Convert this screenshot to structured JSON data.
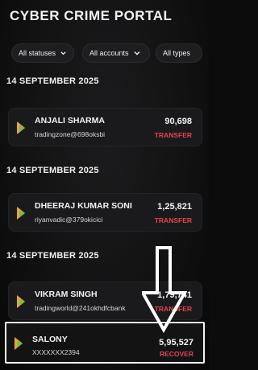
{
  "page": {
    "title": "CYBER CRIME PORTAL"
  },
  "filters": [
    {
      "label": "All statuses",
      "has_chevron": true
    },
    {
      "label": "All accounts",
      "has_chevron": true
    },
    {
      "label": "All types",
      "has_chevron": false
    }
  ],
  "groups": [
    {
      "date": "14 SEPTEMBER 2025",
      "transaction": {
        "name": "ANJALI SHARMA",
        "account": "tradingzone@698oksbi",
        "amount": "90,698",
        "type": "TRANSFER"
      }
    },
    {
      "date": "14 SEPTEMBER 2025",
      "transaction": {
        "name": "DHEERAJ KUMAR SONI",
        "account": "riyanvadic@379okicici",
        "amount": "1,25,821",
        "type": "TRANSFER"
      }
    },
    {
      "date": "14 SEPTEMBER 2025",
      "transaction": {
        "name": "VIKRAM SINGH",
        "account": "tradingworld@241okhdfcbank",
        "amount": "1,79,741",
        "type": "TRANSFER"
      }
    }
  ],
  "highlighted_transaction": {
    "name": "SALONY",
    "account": "XXXXXXX2394",
    "amount": "5,95,527",
    "type": "RECOVER"
  },
  "colors": {
    "background": "#121213",
    "card": "#1a1a1c",
    "accent_red": "#e34450",
    "icon_orange": "#f0a23a",
    "icon_green": "#6cc24a",
    "arrow": "#ffffff"
  },
  "icons": {
    "transaction": "upi-logo-icon",
    "chevron": "chevron-down-icon",
    "annotation": "down-arrow-icon"
  }
}
